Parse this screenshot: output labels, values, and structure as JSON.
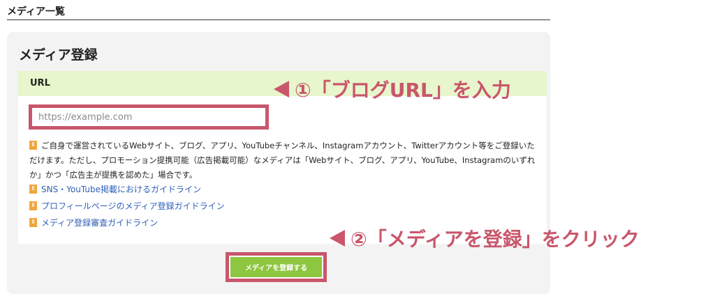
{
  "header": {
    "title": "メディア一覧"
  },
  "card": {
    "title": "メディア登録",
    "url_section_label": "URL",
    "url_input": {
      "placeholder": "https://example.com",
      "value": ""
    },
    "note_text": "ご自身で運営されているWebサイト、ブログ、アプリ、YouTubeチャンネル、Instagramアカウント、Twitterアカウント等をご登録いただけます。ただし、プロモーション提携可能（広告掲載可能）なメディアは「Webサイト、ブログ、アプリ、YouTube、Instagramのいずれか」かつ「広告主が提携を認めた」場合です。",
    "links": [
      {
        "label": "SNS・YouTube掲載におけるガイドライン"
      },
      {
        "label": "プロフィールページのメディア登録ガイドライン"
      },
      {
        "label": "メディア登録審査ガイドライン"
      }
    ],
    "submit_label": "メディアを登録する"
  },
  "annotations": {
    "step1": "①「ブログURL」を入力",
    "step2": "②「メディアを登録」をクリック"
  },
  "colors": {
    "highlight": "#c9566b",
    "accent_green": "#8dc63f",
    "band_green": "#e7f6cc",
    "link_blue": "#2f5fb8",
    "warning_orange": "#f0a63c"
  }
}
